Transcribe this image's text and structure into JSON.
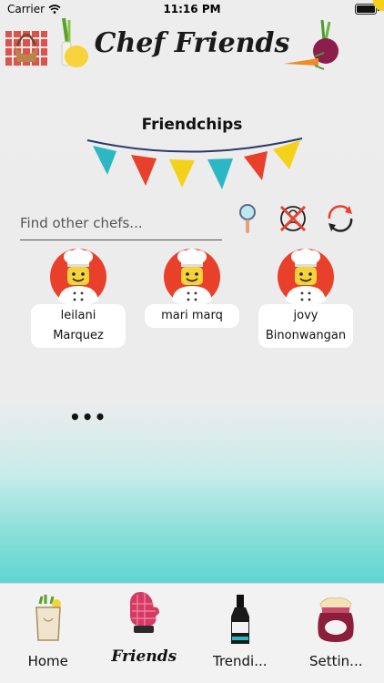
{
  "status_bar": {
    "carrier": "Carrier",
    "time": "11:16 PM"
  },
  "header": {
    "title": "Chef Friends"
  },
  "section": {
    "title": "Friendchips"
  },
  "search": {
    "placeholder": "Find other chefs..."
  },
  "chefs": [
    {
      "name": "leilani Marquez"
    },
    {
      "name": "mari marq"
    },
    {
      "name": "jovy Binonwangan"
    }
  ],
  "more": {
    "label": "•••"
  },
  "tabs": [
    {
      "label": "Home"
    },
    {
      "label": "Friends"
    },
    {
      "label": "Trendi..."
    },
    {
      "label": "Settin..."
    }
  ],
  "colors": {
    "accent": "#5fd6d0",
    "avatar_red": "#e8402a"
  }
}
